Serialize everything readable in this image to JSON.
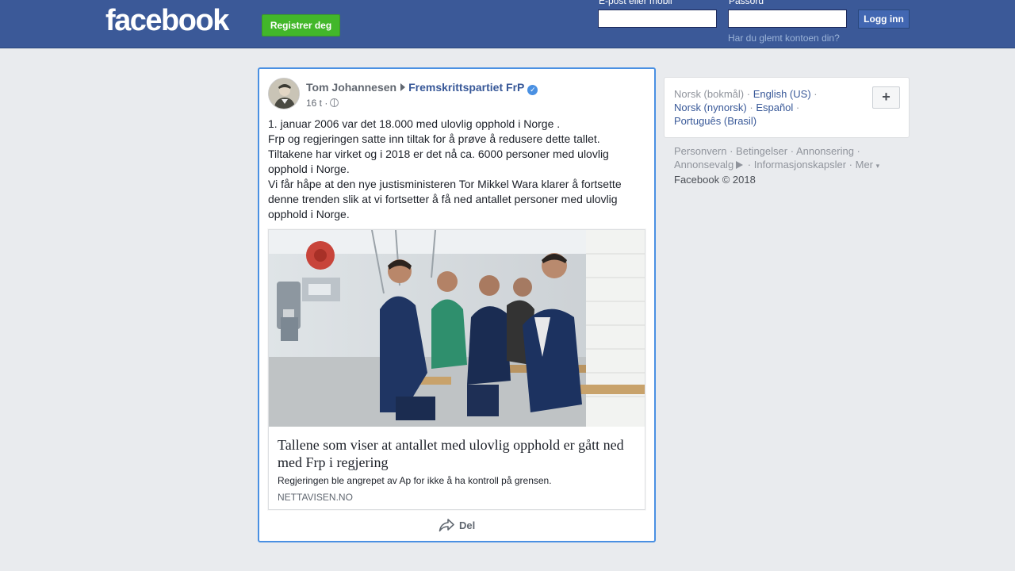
{
  "header": {
    "logo_text": "facebook",
    "register_label": "Registrer deg",
    "email_label": "E-post eller mobil",
    "password_label": "Passord",
    "login_label": "Logg inn",
    "forgot_label": "Har du glemt kontoen din?",
    "brand_color": "#3b5998",
    "register_color": "#42b72a"
  },
  "post": {
    "author": "Tom Johannesen",
    "page": "Fremskrittspartiet FrP",
    "time": "16 t",
    "visibility_icon": "globe-icon",
    "text_lines": [
      "1. januar 2006 var det 18.000 med ulovlig opphold i Norge .",
      "Frp og regjeringen satte inn tiltak for å prøve å redusere dette tallet.",
      "Tiltakene har virket og i 2018 er det nå ca. 6000 personer med ulovlig opphold i Norge.",
      "Vi får håpe at den nye justisministeren Tor Mikkel Wara klarer å fortsette denne trenden slik at vi fortsetter å få ned antallet personer med ulovlig opphold i Norge."
    ],
    "link": {
      "title": "Tallene som viser at antallet med ulovlig opphold er gått ned med Frp i regjering",
      "description": "Regjeringen ble angrepet av Ap for ikke å ha kontroll på grensen.",
      "domain": "NETTAVISEN.NO"
    },
    "share_label": "Del",
    "highlight_color": "#4a90e2"
  },
  "sidebar": {
    "languages": {
      "current": "Norsk (bokmål)",
      "items": [
        "English (US)",
        "Norsk (nynorsk)",
        "Español",
        "Português (Brasil)"
      ]
    },
    "add_language_label": "+",
    "footer": {
      "links": [
        "Personvern",
        "Betingelser",
        "Annonsering",
        "Annonsevalg",
        "Informasjonskapsler",
        "Mer"
      ],
      "copyright": "Facebook © 2018"
    }
  }
}
